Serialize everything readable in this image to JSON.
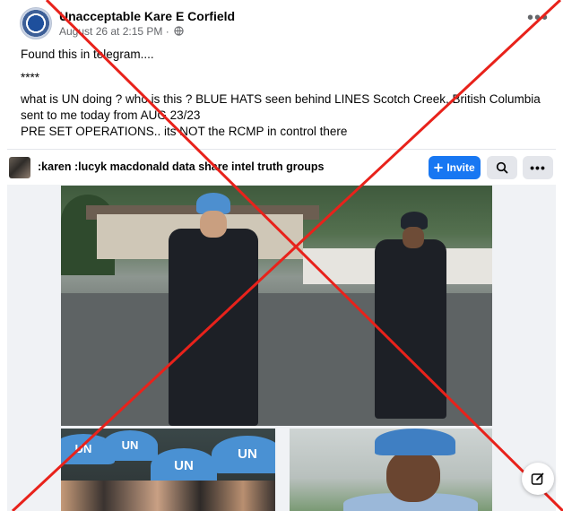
{
  "post": {
    "author": "Unacceptable Kare E Corfield",
    "date": "August 26 at 2:15 PM",
    "separator": "·",
    "privacy_icon": "globe-icon",
    "more_icon": "more-horizontal-icon",
    "more_label": "•••",
    "text": {
      "line1": "Found this in telegram....",
      "line2": "****",
      "line3": "what is UN doing ? who is this ? BLUE HATS seen behind LINES Scotch Creek, British Columbia",
      "line4": "sent to me  today from AUG 23/23",
      "line5": "PRE SET OPERATIONS.. its NOT the RCMP in control there"
    }
  },
  "share_bar": {
    "group_name": ":karen :lucyk macdonald data share intel truth groups",
    "invite_label": "Invite",
    "invite_icon": "plus-icon",
    "search_icon": "search-icon",
    "more_label": "•••"
  },
  "photos": {
    "un_label_1": "UN",
    "un_label_2": "UN",
    "un_label_3": "UN",
    "un_label_4": "UN"
  },
  "overlay": {
    "cross_color": "#e8221b",
    "compose_icon": "compose-icon"
  },
  "colors": {
    "accent": "#1877f2",
    "secondary_text": "#65676b",
    "button_gray": "#e4e6eb"
  }
}
